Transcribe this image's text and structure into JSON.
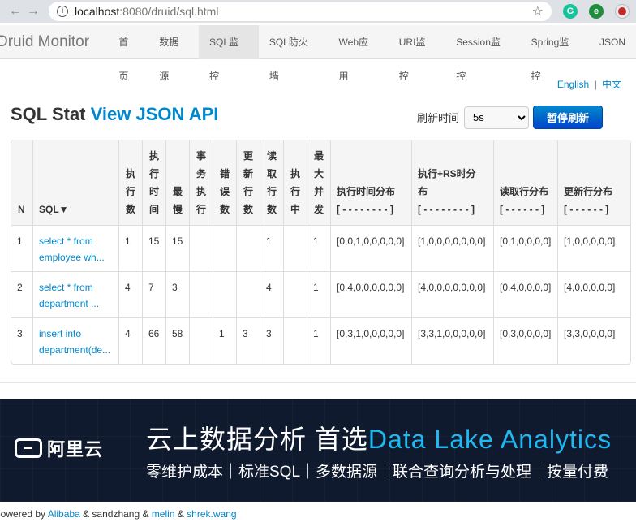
{
  "browser": {
    "back": "←",
    "forward": "→",
    "host": "localhost",
    "path": ":8080/druid/sql.html",
    "star": "☆"
  },
  "navbar": {
    "brand": "Druid Monitor",
    "items": [
      {
        "label": "首页"
      },
      {
        "label": "数据源"
      },
      {
        "label": "SQL监控"
      },
      {
        "label": "SQL防火墙"
      },
      {
        "label": "Web应用"
      },
      {
        "label": "URI监控"
      },
      {
        "label": "Session监控"
      },
      {
        "label": "Spring监控"
      },
      {
        "label": "JSON"
      }
    ]
  },
  "lang": {
    "en": "English",
    "sep": "|",
    "zh": "中文"
  },
  "heading": {
    "title": "SQL Stat",
    "api_link": "View JSON API"
  },
  "refresh": {
    "label": "刷新时间",
    "selected": "5s",
    "pause_button": "暂停刷新"
  },
  "table": {
    "headers": [
      "N",
      "SQL▼",
      "执行数",
      "执行时间",
      "最慢",
      "事务执行",
      "错误数",
      "更新行数",
      "读取行数",
      "执行中",
      "最大并发",
      "执行时间分布\n[ - - - - - - - - ]",
      "执行+RS时分布\n[ - - - - - - - - ]",
      "读取行分布\n[ - - - - - - ]",
      "更新行分布\n[ - - - - - - ]"
    ],
    "rows": [
      [
        "1",
        "select * from employee wh...",
        "1",
        "15",
        "15",
        "",
        "",
        "",
        "1",
        "",
        "1",
        "[0,0,1,0,0,0,0,0]",
        "[1,0,0,0,0,0,0,0]",
        "[0,1,0,0,0,0]",
        "[1,0,0,0,0,0]"
      ],
      [
        "2",
        "select * from department ...",
        "4",
        "7",
        "3",
        "",
        "",
        "",
        "4",
        "",
        "1",
        "[0,4,0,0,0,0,0,0]",
        "[4,0,0,0,0,0,0,0]",
        "[0,4,0,0,0,0]",
        "[4,0,0,0,0,0]"
      ],
      [
        "3",
        "insert into department(de...",
        "4",
        "66",
        "58",
        "",
        "1",
        "3",
        "3",
        "",
        "1",
        "[0,3,1,0,0,0,0,0]",
        "[3,3,1,0,0,0,0,0]",
        "[0,3,0,0,0,0]",
        "[3,3,0,0,0,0]"
      ]
    ]
  },
  "banner": {
    "logo_text": "阿里云",
    "headline": "云上数据分析 首选",
    "headline_accent": "Data Lake Analytics",
    "subline": "零维护成本｜标准SQL｜多数据源｜联合查询分析与处理｜按量付费"
  },
  "footer": {
    "prefix": "powered by ",
    "alibaba": "Alibaba",
    "mid1": " & sandzhang & ",
    "melin": "melin",
    "mid2": " & ",
    "shrek": "shrek.wang"
  }
}
